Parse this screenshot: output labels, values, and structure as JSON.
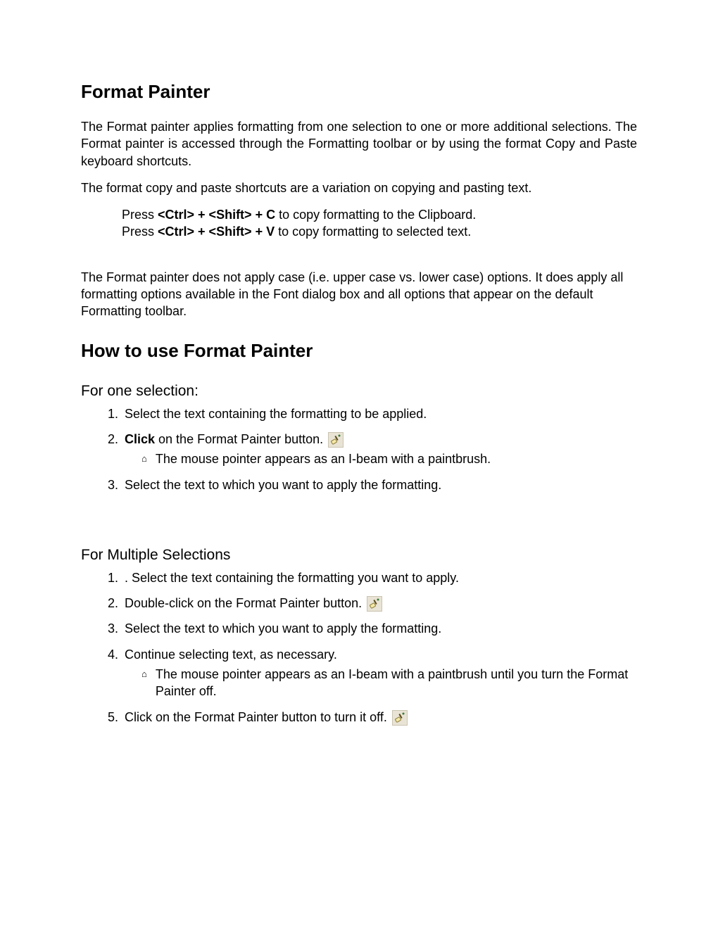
{
  "title": "Format Painter",
  "intro1": "The Format painter applies formatting from one selection to one or more additional selections. The Format painter is accessed through the Formatting toolbar or by using the format Copy and Paste keyboard shortcuts.",
  "intro2": "The format copy and paste shortcuts are a variation on copying and pasting text.",
  "shortcuts": {
    "line1_prefix": "Press ",
    "line1_key": "<Ctrl> + <Shift> + C",
    "line1_suffix": " to copy formatting to the Clipboard.",
    "line2_prefix": "Press ",
    "line2_key": "<Ctrl> + <Shift> + V",
    "line2_suffix": " to copy formatting to selected text."
  },
  "note": "The Format painter does not apply case (i.e. upper case vs. lower case) options. It does apply all formatting options available in the Font dialog box and all options that appear on the default Formatting toolbar.",
  "howto_heading": "How to use Format Painter",
  "one_selection": {
    "heading": "For one selection:",
    "step1": "Select the text containing the formatting to be applied.",
    "step2_bold": "Click",
    "step2_rest": " on the Format Painter button. ",
    "step2_sub": "The mouse pointer appears as an I-beam with a paintbrush.",
    "step3": "Select the text to which you want to apply the formatting."
  },
  "multi_selection": {
    "heading": "For Multiple Selections",
    "step1": ". Select the text containing the formatting you want to apply.",
    "step2": "Double-click on the Format Painter button. ",
    "step3": "Select the text to which you want to apply the formatting.",
    "step4": "Continue selecting text, as necessary.",
    "step4_sub": "The mouse pointer appears as an I-beam with a paintbrush until you turn the Format Painter off.",
    "step5": "Click on the Format Painter button to turn it off. "
  },
  "icons": {
    "format_painter": "format-painter-icon",
    "bullet_glyph": "⌂"
  }
}
